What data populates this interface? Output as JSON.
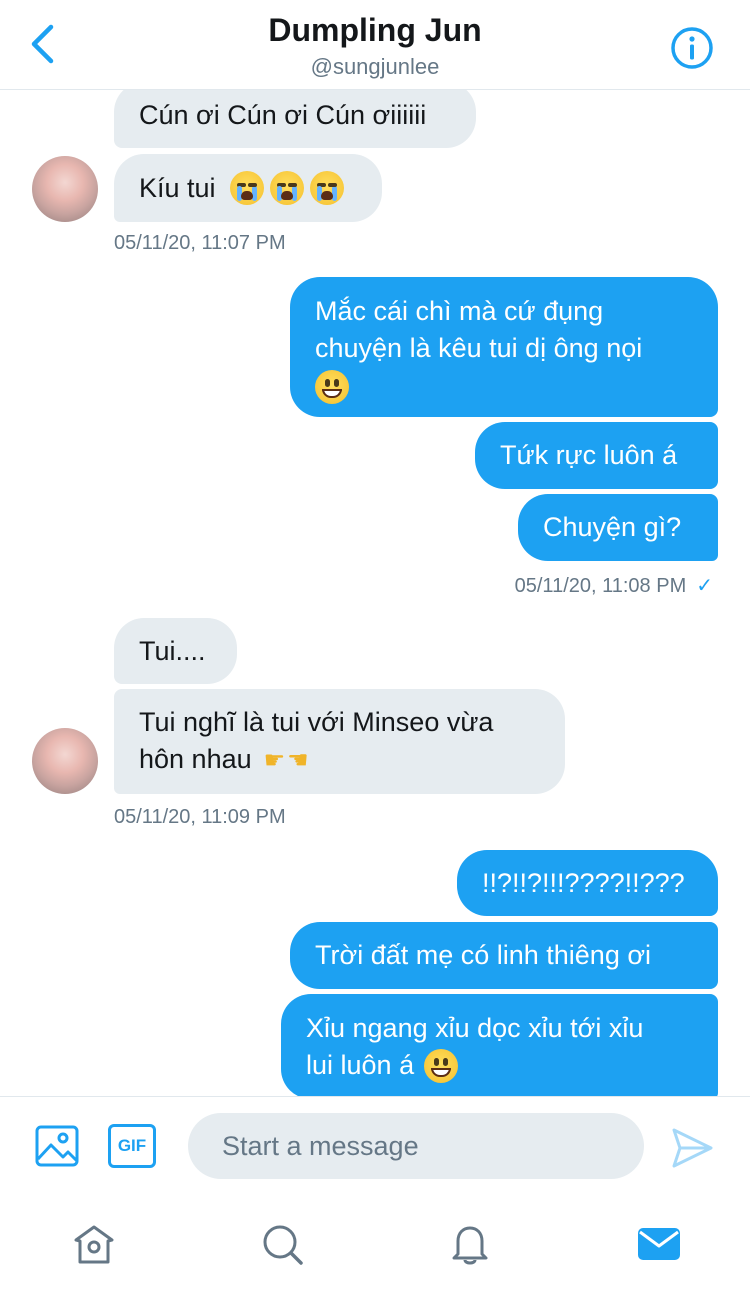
{
  "header": {
    "title": "Dumpling Jun",
    "handle": "@sungjunlee"
  },
  "messages": {
    "m1": "Cún ơi Cún ơi Cún ơiiiiii",
    "m2": "Kíu tui",
    "ts1": "05/11/20, 11:07 PM",
    "m3_line1": "Mắc cái chì mà cứ đụng",
    "m3_line2": "chuyện là kêu tui dị ông nọi",
    "m4": "Tứk rực luôn á",
    "m5": "Chuyện gì?",
    "ts2": "05/11/20, 11:08 PM",
    "m6": "Tui....",
    "m7_line1": "Tui nghĩ là tui với Minseo vừa",
    "m7_line2": "hôn nhau",
    "ts3": "05/11/20, 11:09 PM",
    "m8": "!!?!!?!!!????!!???",
    "m9": "Trời đất mẹ có linh thiêng ơi",
    "m10_line1": "Xỉu ngang xỉu dọc xỉu tới xỉu",
    "m10_line2": "lui luôn á"
  },
  "icons": {
    "emoji_cry": "loudly-crying-face",
    "emoji_grin": "grinning-face",
    "hand_right": "backhand-index-pointing-right",
    "hand_left": "backhand-index-pointing-left",
    "read_receipt": "check-icon"
  },
  "composer": {
    "placeholder": "Start a message",
    "gif_label": "GIF"
  },
  "colors": {
    "accent": "#1da1f2",
    "received_bubble": "#e6ecf0",
    "muted_text": "#657786"
  }
}
